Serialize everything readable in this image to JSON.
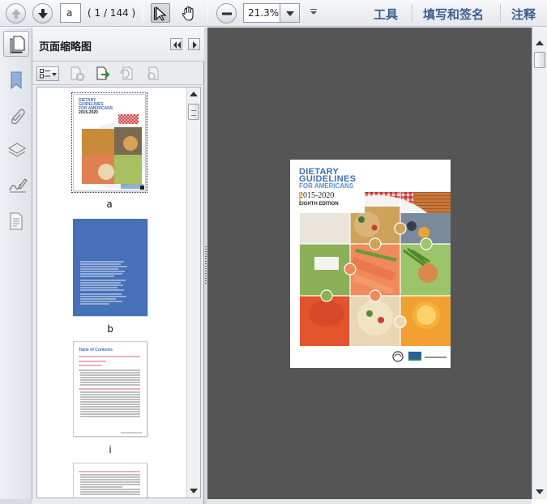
{
  "toolbar": {
    "page_value": "a",
    "page_count": "( 1 / 144 )",
    "zoom_value": "21.3%",
    "tools_label": "工具",
    "sign_label": "填写和签名",
    "comment_label": "注释"
  },
  "panel": {
    "title": "页面缩略图",
    "thumbnails": [
      {
        "label": "a",
        "selected": true
      },
      {
        "label": "b",
        "selected": false
      },
      {
        "label": "i",
        "selected": false
      },
      {
        "label": "",
        "selected": false
      }
    ],
    "toc_title": "Table of Contents"
  },
  "document": {
    "cover_line1": "DIETARY",
    "cover_line2": "GUIDELINES",
    "cover_line3": "FOR AMERICANS",
    "cover_year": "2015-2020",
    "cover_edition": "EIGHTH EDITION",
    "usda": "USDA"
  },
  "colors": {
    "accent_blue": "#3f6fb3",
    "blue_page": "#4670b8",
    "doc_background": "#555555"
  }
}
